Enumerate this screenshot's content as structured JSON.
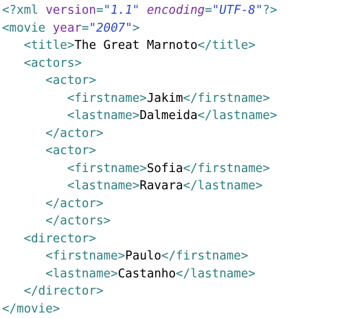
{
  "editor": {
    "lines": [
      {
        "indent": "",
        "parts": [
          {
            "cls": "tag",
            "t": "<?xml "
          },
          {
            "cls": "attr",
            "t": "version"
          },
          {
            "cls": "tag",
            "t": "="
          },
          {
            "cls": "val",
            "t": "\"1.1\""
          },
          {
            "cls": "tag",
            "t": " "
          },
          {
            "cls": "attr-italic",
            "t": "encoding"
          },
          {
            "cls": "tag",
            "t": "="
          },
          {
            "cls": "val",
            "t": "\"UTF-8\""
          },
          {
            "cls": "tag",
            "t": "?>"
          }
        ]
      },
      {
        "indent": "",
        "parts": [
          {
            "cls": "tag",
            "t": "<movie "
          },
          {
            "cls": "attr",
            "t": "year"
          },
          {
            "cls": "tag",
            "t": "="
          },
          {
            "cls": "val",
            "t": "\"2007\""
          },
          {
            "cls": "tag",
            "t": ">"
          }
        ]
      },
      {
        "indent": "   ",
        "parts": [
          {
            "cls": "tag",
            "t": "<title>"
          },
          {
            "cls": "text",
            "t": "The Great Marnoto"
          },
          {
            "cls": "tag",
            "t": "</title>"
          }
        ]
      },
      {
        "indent": "   ",
        "parts": [
          {
            "cls": "tag",
            "t": "<actors>"
          }
        ]
      },
      {
        "indent": "      ",
        "parts": [
          {
            "cls": "tag",
            "t": "<actor>"
          }
        ]
      },
      {
        "indent": "         ",
        "parts": [
          {
            "cls": "tag",
            "t": "<firstname>"
          },
          {
            "cls": "text",
            "t": "Jakim"
          },
          {
            "cls": "tag",
            "t": "</firstname>"
          }
        ]
      },
      {
        "indent": "         ",
        "parts": [
          {
            "cls": "tag",
            "t": "<lastname>"
          },
          {
            "cls": "text",
            "t": "Dalmeida"
          },
          {
            "cls": "tag",
            "t": "</lastname>"
          }
        ]
      },
      {
        "indent": "      ",
        "parts": [
          {
            "cls": "tag",
            "t": "</actor>"
          }
        ]
      },
      {
        "indent": "      ",
        "parts": [
          {
            "cls": "tag",
            "t": "<actor>"
          }
        ]
      },
      {
        "indent": "         ",
        "parts": [
          {
            "cls": "tag",
            "t": "<firstname>"
          },
          {
            "cls": "text",
            "t": "Sofia"
          },
          {
            "cls": "tag",
            "t": "</firstname>"
          }
        ]
      },
      {
        "indent": "         ",
        "parts": [
          {
            "cls": "tag",
            "t": "<lastname>"
          },
          {
            "cls": "text",
            "t": "Ravara"
          },
          {
            "cls": "tag",
            "t": "</lastname>"
          }
        ]
      },
      {
        "indent": "      ",
        "parts": [
          {
            "cls": "tag",
            "t": "</actor>"
          }
        ]
      },
      {
        "indent": "      ",
        "parts": [
          {
            "cls": "tag",
            "t": "</actors>"
          }
        ]
      },
      {
        "indent": "   ",
        "parts": [
          {
            "cls": "tag",
            "t": "<director>"
          }
        ]
      },
      {
        "indent": "      ",
        "parts": [
          {
            "cls": "tag",
            "t": "<firstname>"
          },
          {
            "cls": "text",
            "t": "Paulo"
          },
          {
            "cls": "tag",
            "t": "</firstname>"
          }
        ]
      },
      {
        "indent": "      ",
        "parts": [
          {
            "cls": "tag",
            "t": "<lastname>"
          },
          {
            "cls": "text",
            "t": "Castanho"
          },
          {
            "cls": "tag",
            "t": "</lastname>"
          }
        ]
      },
      {
        "indent": "   ",
        "parts": [
          {
            "cls": "tag",
            "t": "</director>"
          }
        ]
      },
      {
        "indent": "",
        "parts": [
          {
            "cls": "tag",
            "t": "</movie>"
          }
        ]
      }
    ]
  },
  "colors": {
    "tag": "#2a7f7f",
    "attribute": "#7d2ea0",
    "value": "#2b47cf",
    "text": "#000000",
    "background": "#ffffff"
  }
}
